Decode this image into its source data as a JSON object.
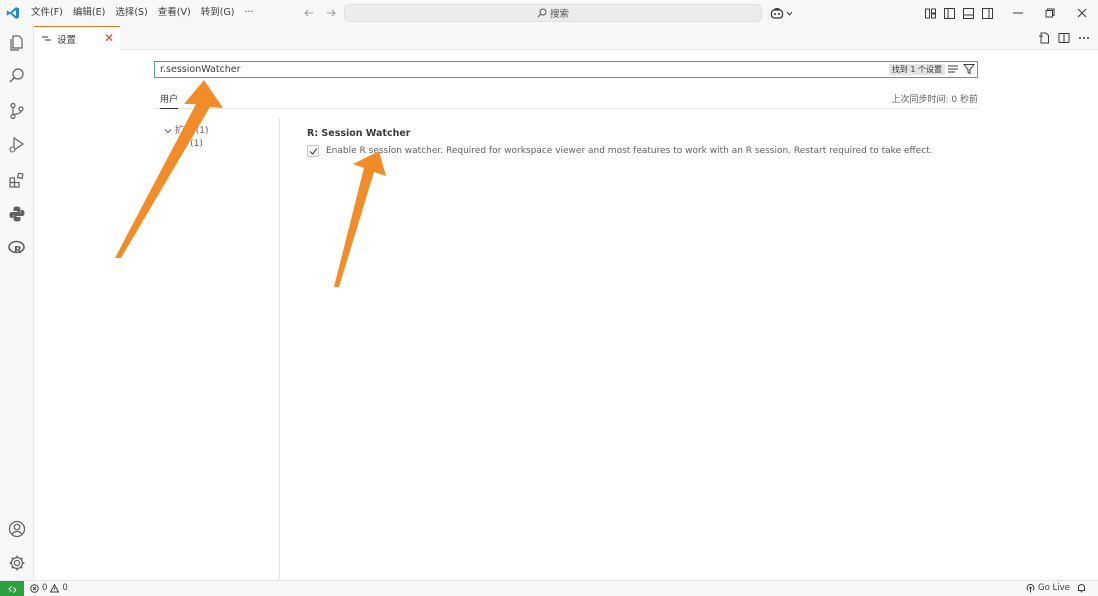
{
  "menu": [
    "文件(F)",
    "编辑(E)",
    "选择(S)",
    "查看(V)",
    "转到(G)",
    "···"
  ],
  "command_center": {
    "label": "搜索"
  },
  "tab": {
    "title": "设置",
    "close": "✕"
  },
  "settings": {
    "search_value": "r.sessionWatcher",
    "found_label": "找到 1 个设置",
    "scope_tab": "用户",
    "sync_status": "上次同步时间: 0 秒前",
    "toc": [
      {
        "label": "扩展 (1)"
      },
      {
        "label": "R (1)"
      }
    ],
    "setting_title": "R: Session Watcher",
    "setting_description": "Enable R session watcher. Required for workspace viewer and most features to work with an R session. Restart required to take effect.",
    "setting_checked": true
  },
  "statusbar": {
    "errors": "0",
    "warnings": "0",
    "golive": "Go Live"
  },
  "colors": {
    "accent_orange": "#f28c28",
    "remote_green": "#2ea043",
    "search_border": "#5aa28a"
  }
}
